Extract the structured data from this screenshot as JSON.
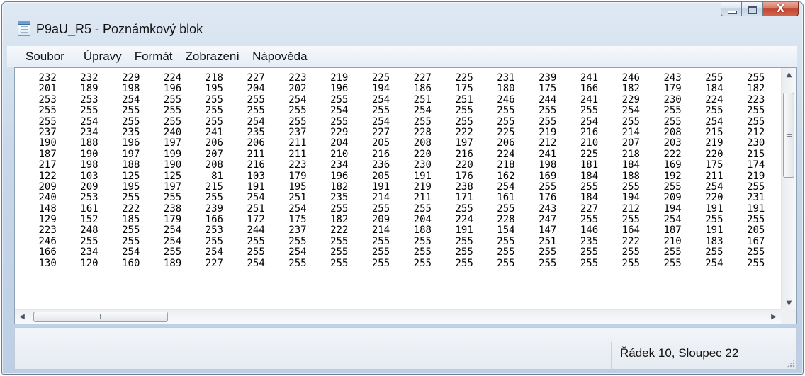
{
  "window": {
    "title": "P9aU_R5 - Poznámkový blok"
  },
  "caption": {
    "close_glyph": "X"
  },
  "menu": [
    "Soubor",
    "Úpravy",
    "Formát",
    "Zobrazení",
    "Nápověda"
  ],
  "rows": [
    [
      232,
      232,
      229,
      224,
      218,
      227,
      223,
      219,
      225,
      227,
      225,
      231,
      239,
      241,
      246,
      243,
      255,
      255
    ],
    [
      201,
      189,
      198,
      196,
      195,
      204,
      202,
      196,
      194,
      186,
      175,
      180,
      175,
      166,
      182,
      179,
      184,
      182
    ],
    [
      253,
      253,
      254,
      255,
      255,
      255,
      254,
      255,
      254,
      251,
      251,
      246,
      244,
      241,
      229,
      230,
      224,
      223
    ],
    [
      255,
      255,
      255,
      255,
      255,
      255,
      255,
      254,
      255,
      254,
      255,
      255,
      255,
      255,
      254,
      255,
      255,
      255
    ],
    [
      255,
      254,
      255,
      255,
      255,
      254,
      255,
      255,
      254,
      255,
      255,
      255,
      255,
      254,
      255,
      255,
      254,
      255
    ],
    [
      237,
      234,
      235,
      240,
      241,
      235,
      237,
      229,
      227,
      228,
      222,
      225,
      219,
      216,
      214,
      208,
      215,
      212
    ],
    [
      190,
      188,
      196,
      197,
      206,
      206,
      211,
      204,
      205,
      208,
      197,
      206,
      212,
      210,
      207,
      203,
      219,
      230
    ],
    [
      187,
      190,
      197,
      199,
      207,
      211,
      211,
      210,
      216,
      220,
      216,
      224,
      241,
      225,
      218,
      222,
      220,
      215
    ],
    [
      217,
      198,
      188,
      190,
      208,
      216,
      223,
      234,
      236,
      230,
      220,
      218,
      198,
      181,
      184,
      169,
      175,
      174
    ],
    [
      122,
      103,
      125,
      125,
      81,
      103,
      179,
      196,
      205,
      191,
      176,
      162,
      169,
      184,
      188,
      192,
      211,
      219
    ],
    [
      209,
      209,
      195,
      197,
      215,
      191,
      195,
      182,
      191,
      219,
      238,
      254,
      255,
      255,
      255,
      255,
      254,
      255
    ],
    [
      240,
      253,
      255,
      255,
      255,
      254,
      251,
      235,
      214,
      211,
      171,
      161,
      176,
      184,
      194,
      209,
      220,
      231
    ],
    [
      148,
      161,
      222,
      238,
      239,
      251,
      254,
      255,
      255,
      255,
      255,
      255,
      243,
      227,
      212,
      194,
      191,
      191
    ],
    [
      129,
      152,
      185,
      179,
      166,
      172,
      175,
      182,
      209,
      204,
      224,
      228,
      247,
      255,
      255,
      254,
      255,
      255
    ],
    [
      223,
      248,
      255,
      254,
      253,
      244,
      237,
      222,
      214,
      188,
      191,
      154,
      147,
      146,
      164,
      187,
      191,
      205
    ],
    [
      246,
      255,
      255,
      254,
      255,
      255,
      255,
      255,
      255,
      255,
      255,
      255,
      251,
      235,
      222,
      210,
      183,
      167
    ],
    [
      166,
      234,
      254,
      255,
      254,
      255,
      254,
      255,
      255,
      255,
      255,
      255,
      255,
      255,
      255,
      255,
      255,
      255
    ],
    [
      130,
      120,
      160,
      189,
      227,
      254,
      255,
      255,
      255,
      255,
      255,
      255,
      255,
      255,
      255,
      255,
      254,
      255
    ]
  ],
  "hscroll": {
    "grip": "III"
  },
  "status": {
    "position": "Řádek 10, Sloupec 22"
  }
}
